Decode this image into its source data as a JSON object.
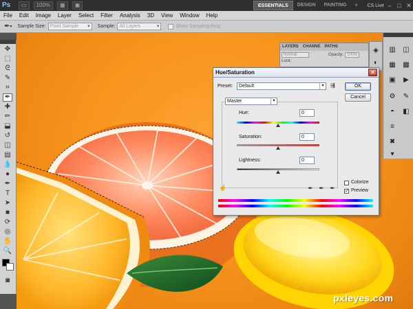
{
  "app": {
    "logo": "Ps",
    "zoom": "100%",
    "workspaces": [
      "ESSENTIALS",
      "DESIGN",
      "PAINTING"
    ],
    "workspace_more": "»",
    "cs_live": "CS Live"
  },
  "menu": [
    "File",
    "Edit",
    "Image",
    "Layer",
    "Select",
    "Filter",
    "Analysis",
    "3D",
    "View",
    "Window",
    "Help"
  ],
  "options": {
    "sample_size_label": "Sample Size:",
    "sample_size_value": "Point Sample",
    "sample_label": "Sample:",
    "sample_value": "All Layers",
    "show_ring_label": "Show Sampling Ring"
  },
  "layers_panel": {
    "tabs": [
      "LAYERS",
      "CHANNE",
      "PATHS"
    ],
    "blend_mode": "Normal",
    "opacity_label": "Opacity:",
    "opacity_value": "100%",
    "lock_label": "Lock:"
  },
  "dialog": {
    "title": "Hue/Saturation",
    "preset_label": "Preset:",
    "preset_value": "Default",
    "ok_label": "OK",
    "cancel_label": "Cancel",
    "channel_value": "Master",
    "hue_label": "Hue:",
    "hue_value": "0",
    "saturation_label": "Saturation:",
    "saturation_value": "0",
    "lightness_label": "Lightness:",
    "lightness_value": "0",
    "colorize_label": "Colorize",
    "colorize_checked": false,
    "preview_label": "Preview",
    "preview_checked": true,
    "preview_check_mark": "✓",
    "hue_level": 0.5,
    "saturation_level": 0.5,
    "lightness_level": 0.5
  },
  "watermark": "pxleyes.com"
}
